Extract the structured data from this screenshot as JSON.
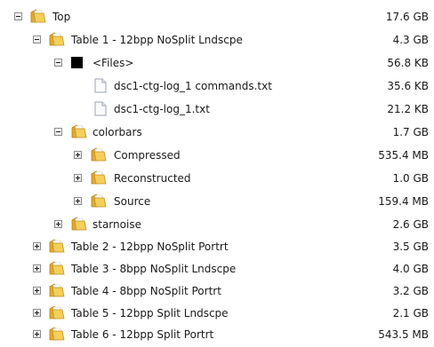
{
  "tree": {
    "top": {
      "label": "Top",
      "size": "17.6 GB"
    },
    "table1": {
      "label": "Table 1 - 12bpp NoSplit Lndscpe",
      "size": "4.3 GB"
    },
    "files": {
      "label": "<Files>",
      "size": "56.8 KB"
    },
    "file_commands": {
      "label": "dsc1-ctg-log_1 commands.txt",
      "size": "35.6 KB"
    },
    "file_log": {
      "label": "dsc1-ctg-log_1.txt",
      "size": "21.2 KB"
    },
    "colorbars": {
      "label": "colorbars",
      "size": "1.7 GB"
    },
    "compressed": {
      "label": "Compressed",
      "size": "535.4 MB"
    },
    "reconstructed": {
      "label": "Reconstructed",
      "size": "1.0 GB"
    },
    "source": {
      "label": "Source",
      "size": "159.4 MB"
    },
    "starnoise": {
      "label": "starnoise",
      "size": "2.6 GB"
    },
    "table2": {
      "label": "Table 2 - 12bpp NoSplit Portrt",
      "size": "3.5 GB"
    },
    "table3": {
      "label": "Table 3 - 8bpp NoSplit Lndscpe",
      "size": "4.0 GB"
    },
    "table4": {
      "label": "Table 4 - 8bpp NoSplit Portrt",
      "size": "3.2 GB"
    },
    "table5": {
      "label": "Table 5 - 12bpp Split Lndscpe",
      "size": "2.1 GB"
    },
    "table6": {
      "label": "Table 6 - 12bpp Split Portrt",
      "size": "543.5 MB"
    }
  },
  "icons": {
    "folder": "folder-icon",
    "document": "document-icon",
    "files_group": "files-group-icon",
    "expanded_toggle": "minus-toggle",
    "collapsed_toggle": "plus-toggle"
  },
  "colors": {
    "folder_body": "#e8b83a",
    "folder_front": "#f6d46a",
    "toggle_border": "#8a8a8a",
    "document_border": "#9aa4b0",
    "text": "#1a1a1a"
  }
}
